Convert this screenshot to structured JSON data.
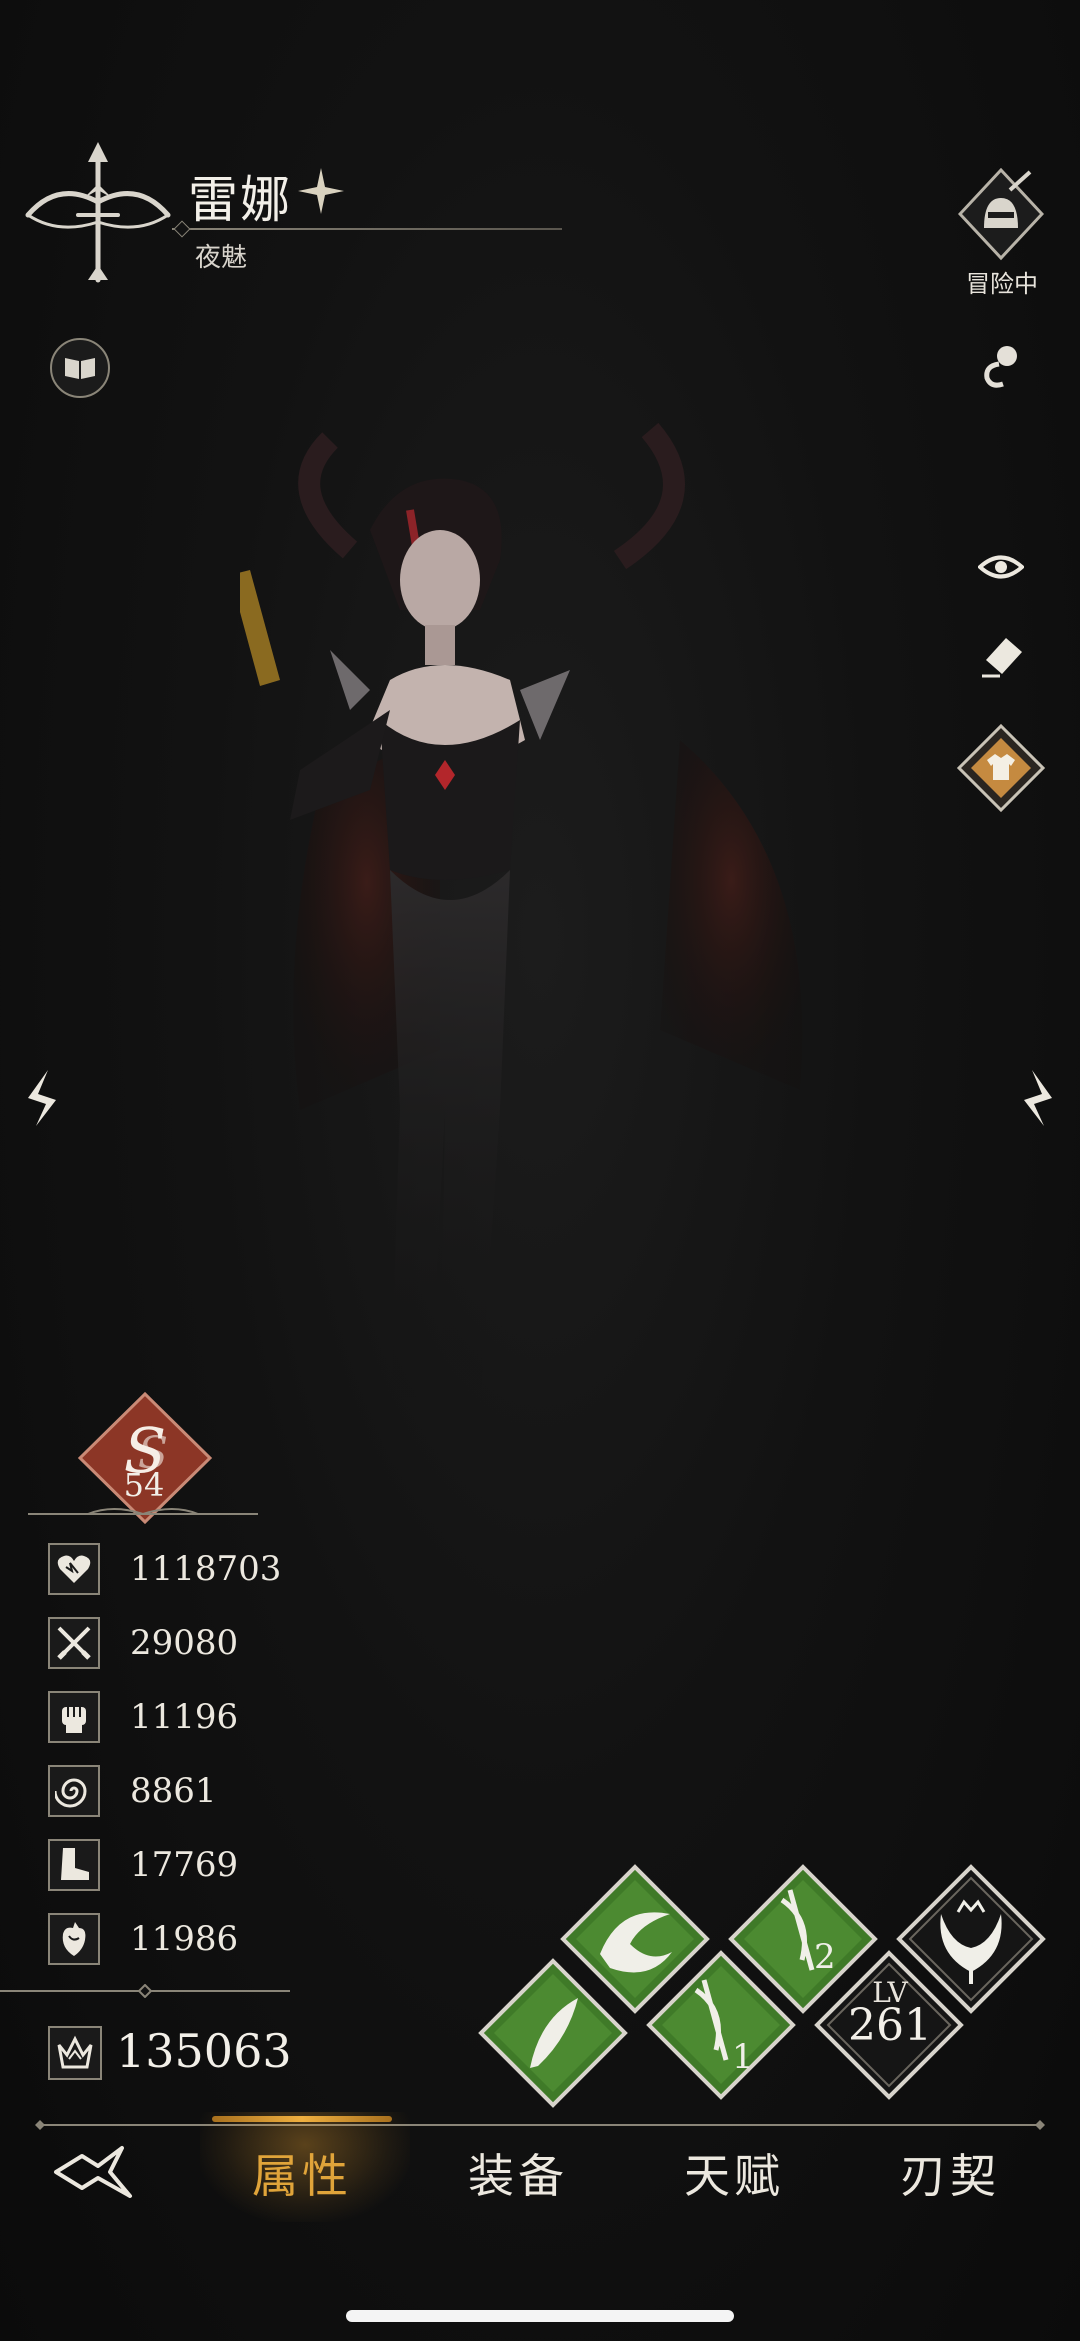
{
  "header": {
    "name": "雷娜",
    "title": "夜魅",
    "status_label": "冒险中"
  },
  "rank": {
    "grade": "S",
    "level": "54"
  },
  "stats": [
    {
      "icon": "heart-icon",
      "value": "1118703"
    },
    {
      "icon": "crossed-swords-icon",
      "value": "29080"
    },
    {
      "icon": "fist-icon",
      "value": "11196"
    },
    {
      "icon": "vortex-icon",
      "value": "8861"
    },
    {
      "icon": "boot-icon",
      "value": "17769"
    },
    {
      "icon": "anatomical-heart-icon",
      "value": "11986"
    }
  ],
  "power": {
    "icon": "crown-icon",
    "value": "135063"
  },
  "skills": {
    "skill_2_label": "2",
    "skill_1_label": "1",
    "level_label": "LV",
    "level_value": "261"
  },
  "tabs": [
    {
      "label": "属性",
      "active": true
    },
    {
      "label": "装备",
      "active": false
    },
    {
      "label": "天赋",
      "active": false
    },
    {
      "label": "刃契",
      "active": false
    }
  ],
  "colors": {
    "accent": "#e0a43a",
    "skill_green": "#4a8a2e",
    "rank_red": "#8c3626"
  }
}
